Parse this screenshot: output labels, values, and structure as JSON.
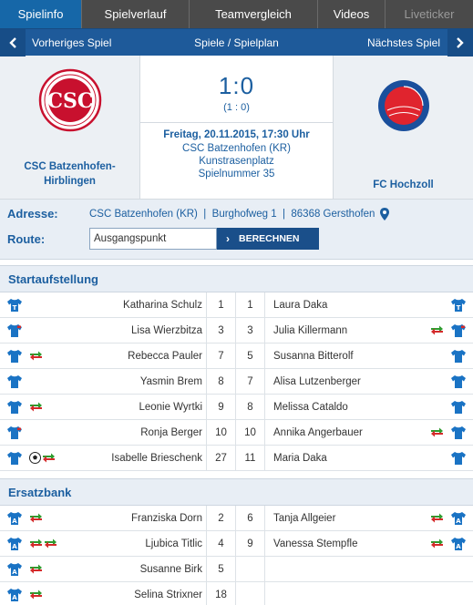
{
  "tabs": [
    {
      "label": "Spielinfo",
      "active": true
    },
    {
      "label": "Spielverlauf"
    },
    {
      "label": "Teamvergleich"
    },
    {
      "label": "Videos"
    },
    {
      "label": "Liveticker",
      "disabled": true
    }
  ],
  "nav": {
    "prev": "Vorheriges Spiel",
    "middle": "Spiele / Spielplan",
    "next": "Nächstes Spiel"
  },
  "match": {
    "home": {
      "name_line1": "CSC Batzenhofen-",
      "name_line2": "Hirblingen"
    },
    "away": {
      "name": "FC Hochzoll"
    },
    "score": "1:0",
    "halftime": "(1 : 0)",
    "date": "Freitag, 20.11.2015, 17:30 Uhr",
    "venue": "CSC Batzenhofen (KR)",
    "pitch": "Kunstrasenplatz",
    "game_number": "Spielnummer 35"
  },
  "address": {
    "label": "Adresse:",
    "value": "CSC Batzenhofen (KR)  |  Burghofweg 1  |  86368 Gersthofen",
    "route_label": "Route:",
    "route_placeholder": "Ausgangspunkt",
    "calc_label": "BERECHNEN"
  },
  "lineup": {
    "title": "Startaufstellung",
    "rows": [
      {
        "home": "Katharina Schulz",
        "home_num": "1",
        "away_num": "1",
        "away": "Laura Daka",
        "home_icon": "keeper-jersey-icon",
        "away_icon": "keeper-jersey-icon",
        "home_events": [],
        "away_events": []
      },
      {
        "home": "Lisa Wierzbitza",
        "home_num": "3",
        "away_num": "3",
        "away": "Julia Killermann",
        "home_icon": "captain-jersey-icon",
        "away_icon": "captain-jersey-icon",
        "home_events": [],
        "away_events": [
          "substitution"
        ]
      },
      {
        "home": "Rebecca Pauler",
        "home_num": "7",
        "away_num": "5",
        "away": "Susanna Bitterolf",
        "home_icon": "jersey-icon",
        "away_icon": "jersey-icon",
        "home_events": [
          "substitution"
        ],
        "away_events": []
      },
      {
        "home": "Yasmin Brem",
        "home_num": "8",
        "away_num": "7",
        "away": "Alisa Lutzenberger",
        "home_icon": "jersey-icon",
        "away_icon": "jersey-icon",
        "home_events": [],
        "away_events": []
      },
      {
        "home": "Leonie Wyrtki",
        "home_num": "9",
        "away_num": "8",
        "away": "Melissa Cataldo",
        "home_icon": "jersey-icon",
        "away_icon": "jersey-icon",
        "home_events": [
          "substitution"
        ],
        "away_events": []
      },
      {
        "home": "Ronja Berger",
        "home_num": "10",
        "away_num": "10",
        "away": "Annika Angerbauer",
        "home_icon": "captain-jersey-icon",
        "away_icon": "jersey-icon",
        "home_events": [],
        "away_events": [
          "substitution"
        ]
      },
      {
        "home": "Isabelle Brieschenk",
        "home_num": "27",
        "away_num": "11",
        "away": "Maria Daka",
        "home_icon": "jersey-icon",
        "away_icon": "jersey-icon",
        "home_events": [
          "goal",
          "substitution"
        ],
        "away_events": []
      }
    ]
  },
  "bench": {
    "title": "Ersatzbank",
    "rows": [
      {
        "home": "Franziska Dorn",
        "home_num": "2",
        "away_num": "6",
        "away": "Tanja Allgeier",
        "home_events": [
          "substitution"
        ],
        "away_events": [
          "substitution"
        ]
      },
      {
        "home": "Ljubica Titlic",
        "home_num": "4",
        "away_num": "9",
        "away": "Vanessa Stempfle",
        "home_events": [
          "substitution",
          "substitution"
        ],
        "away_events": [
          "substitution"
        ]
      },
      {
        "home": "Susanne Birk",
        "home_num": "5",
        "away_num": "",
        "away": "",
        "home_events": [
          "substitution"
        ],
        "away_events": []
      },
      {
        "home": "Selina Strixner",
        "home_num": "18",
        "away_num": "",
        "away": "",
        "home_events": [
          "substitution"
        ],
        "away_events": []
      }
    ]
  },
  "colors": {
    "accent": "#1c5fa0",
    "tab_active": "#1667a8",
    "tab_bg": "#4a4a4a",
    "nav_bg": "#1e5a9a",
    "jersey": "#1a73c4",
    "sub_in": "#2e9b2e",
    "sub_out": "#d42a2a"
  }
}
